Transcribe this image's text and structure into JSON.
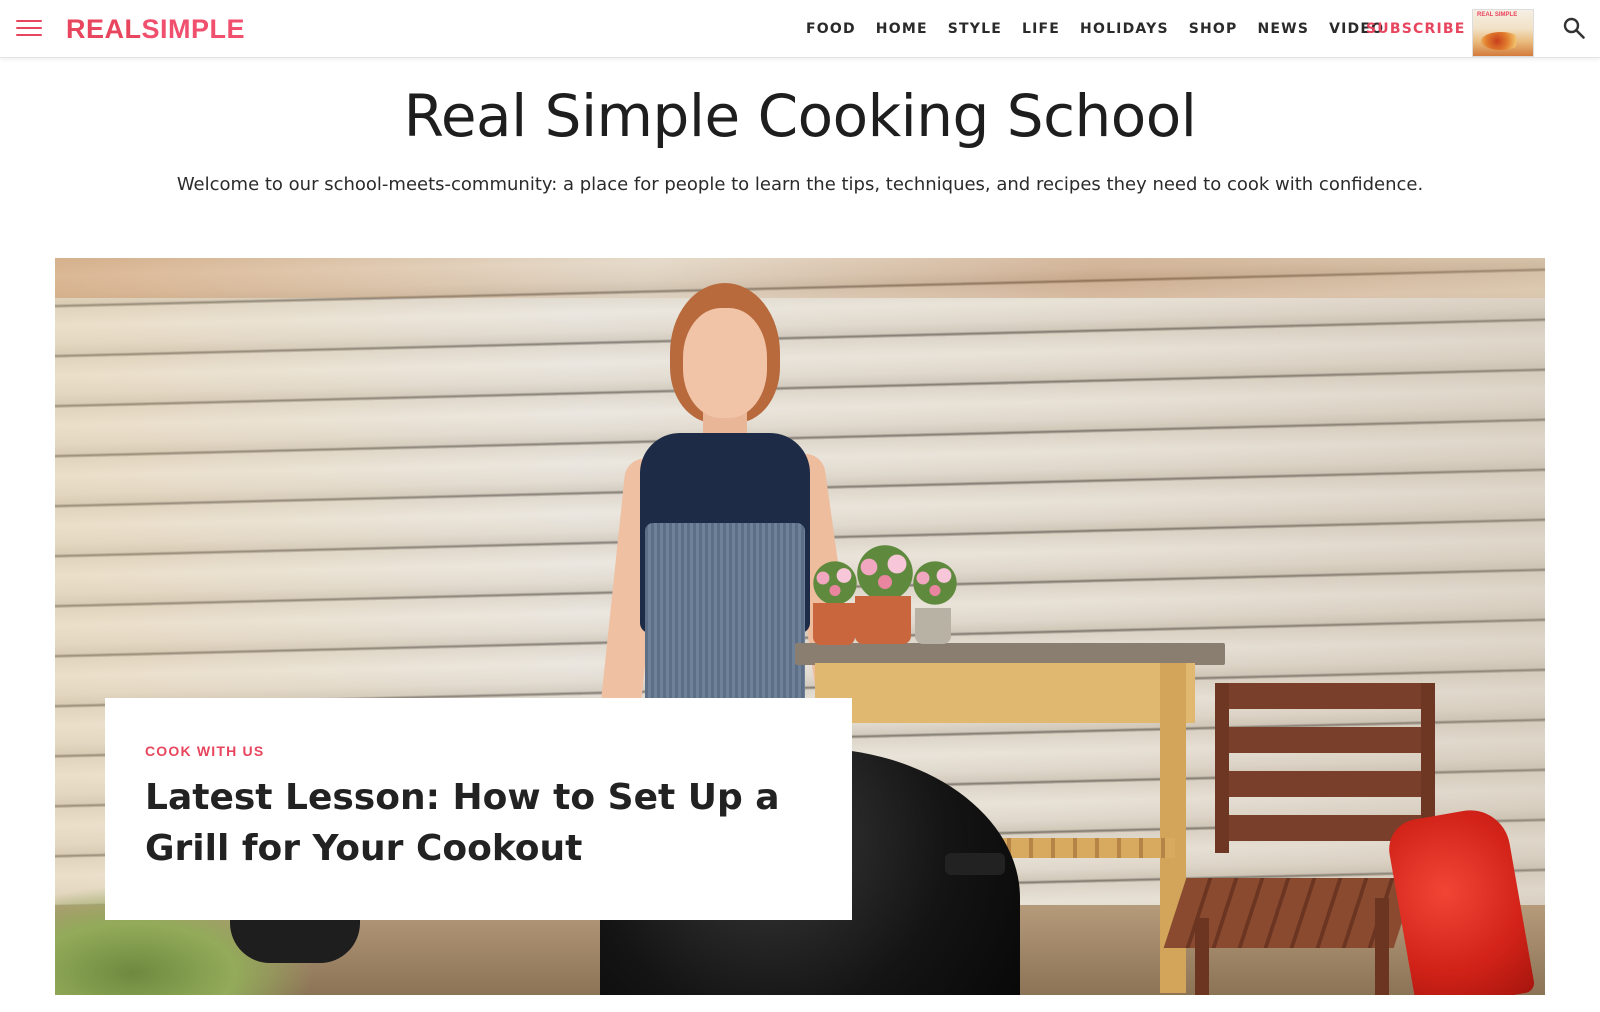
{
  "header": {
    "logo_part1": "REAL",
    "logo_part2": "SIMPLE",
    "nav": [
      "FOOD",
      "HOME",
      "STYLE",
      "LIFE",
      "HOLIDAYS",
      "SHOP",
      "NEWS",
      "VIDEO"
    ],
    "subscribe_label": "SUBSCRIBE",
    "magazine_cover_text": "REAL SIMPLE",
    "icons": {
      "menu": "menu-icon",
      "search": "search-icon"
    },
    "accent_color": "#e8455e"
  },
  "main": {
    "title": "Real Simple Cooking School",
    "subtitle": "Welcome to our school-meets-community: a place for people to learn the tips, techniques, and recipes they need to cook with confidence.",
    "featured": {
      "kicker": "COOK WITH US",
      "headline": "Latest Lesson: How to Set Up a Grill for Your Cookout"
    }
  }
}
